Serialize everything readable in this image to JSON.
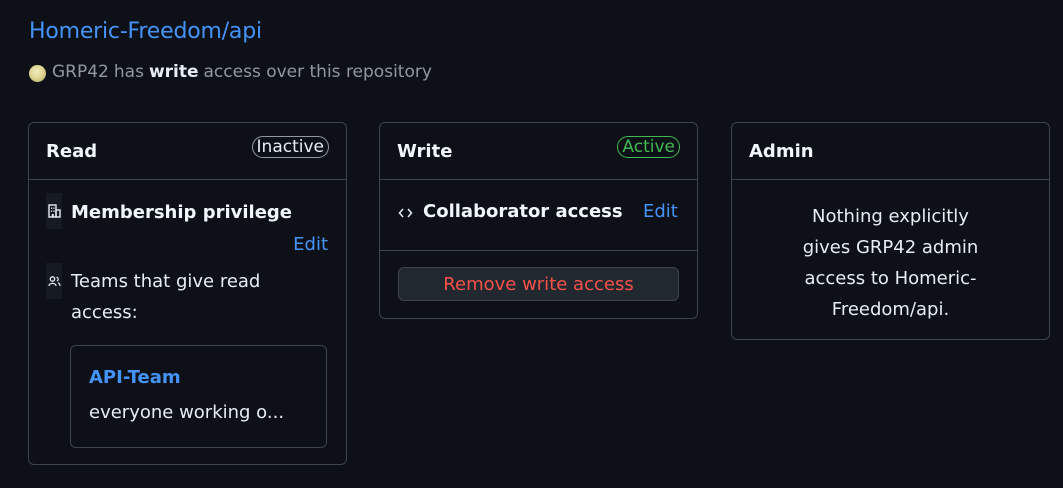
{
  "repo": {
    "link_text": "Homeric-Freedom/api"
  },
  "subtitle": {
    "user": "GRP42",
    "has": "has",
    "permission": "write",
    "rest": "access over this repository"
  },
  "cards": {
    "read": {
      "title": "Read",
      "status": "Inactive",
      "membership_label": "Membership privilege",
      "edit_label": "Edit",
      "teams_label_line1": "Teams that give read",
      "teams_label_line2": "access:",
      "team": {
        "name": "API-Team",
        "description": "everyone working o..."
      }
    },
    "write": {
      "title": "Write",
      "status": "Active",
      "collaborator_label": "Collaborator access",
      "edit_label": "Edit",
      "remove_label": "Remove write access"
    },
    "admin": {
      "title": "Admin",
      "message_line1": "Nothing explicitly",
      "message_line2": "gives GRP42 admin",
      "message_line3": "access to Homeric-",
      "message_line4": "Freedom/api."
    }
  },
  "colors": {
    "link": "#4493f8",
    "active": "#3fb950",
    "danger": "#f85149",
    "border": "#3d444d",
    "background": "#0d1117"
  },
  "icons": {
    "avatar": "user-avatar",
    "membership": "organization-icon",
    "teams": "people-icon",
    "collaborator": "code-icon"
  }
}
